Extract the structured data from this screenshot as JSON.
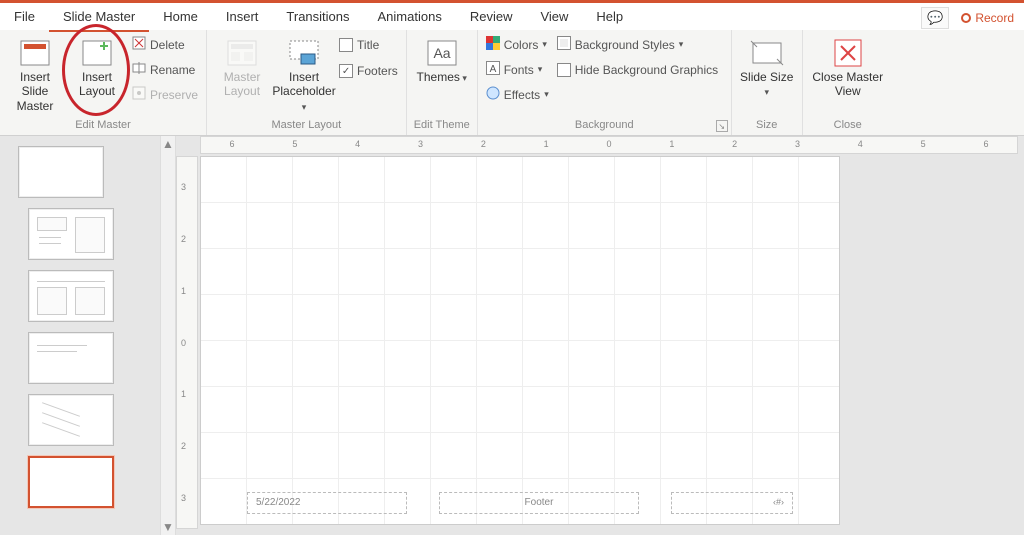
{
  "tabs": {
    "file": "File",
    "slide_master": "Slide Master",
    "home": "Home",
    "insert": "Insert",
    "transitions": "Transitions",
    "animations": "Animations",
    "review": "Review",
    "view": "View",
    "help": "Help"
  },
  "record": "Record",
  "ribbon": {
    "edit_master": {
      "insert_slide_master": "Insert Slide Master",
      "insert_layout": "Insert Layout",
      "delete": "Delete",
      "rename": "Rename",
      "preserve": "Preserve",
      "label": "Edit Master"
    },
    "master_layout_group": {
      "master_layout": "Master Layout",
      "insert_placeholder": "Insert Placeholder",
      "title": "Title",
      "footers": "Footers",
      "label": "Master Layout"
    },
    "edit_theme": {
      "themes": "Themes",
      "label": "Edit Theme"
    },
    "background": {
      "colors": "Colors",
      "fonts": "Fonts",
      "effects": "Effects",
      "bg_styles": "Background Styles",
      "hide_bg": "Hide Background Graphics",
      "label": "Background"
    },
    "size": {
      "slide_size": "Slide Size",
      "label": "Size"
    },
    "close": {
      "close_master": "Close Master View",
      "label": "Close"
    }
  },
  "ruler_h": [
    "6",
    "5",
    "4",
    "3",
    "2",
    "1",
    "0",
    "1",
    "2",
    "3",
    "4",
    "5",
    "6"
  ],
  "ruler_v": [
    "3",
    "2",
    "1",
    "0",
    "1",
    "2",
    "3"
  ],
  "slide": {
    "date": "5/22/2022",
    "footer": "Footer",
    "number_token": "‹#›"
  }
}
